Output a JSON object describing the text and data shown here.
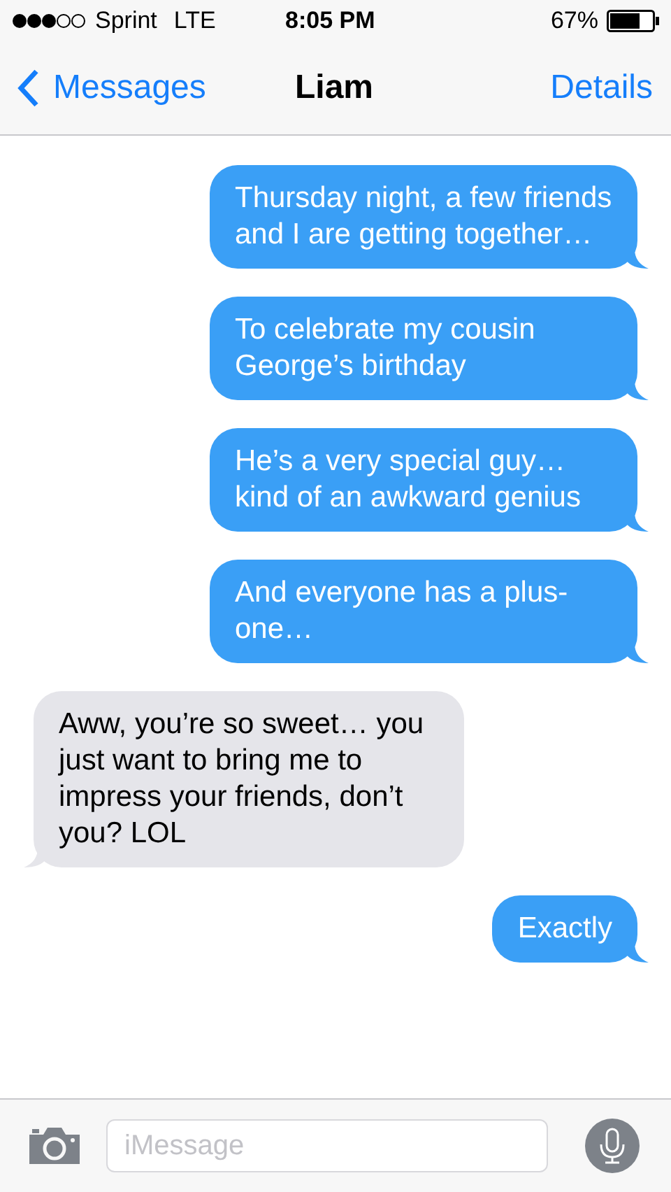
{
  "status_bar": {
    "carrier": "Sprint",
    "network": "LTE",
    "time": "8:05 PM",
    "battery": "67%"
  },
  "nav": {
    "back": "Messages",
    "title": "Liam",
    "action": "Details"
  },
  "messages": [
    {
      "kind": "sent",
      "text": "Thursday night, a few friends and I are getting together…"
    },
    {
      "kind": "sent",
      "text": "To celebrate my cousin George’s birthday"
    },
    {
      "kind": "sent",
      "text": "He’s a very special guy… kind of an awkward genius"
    },
    {
      "kind": "sent",
      "text": "And everyone has a plus-one…"
    },
    {
      "kind": "received",
      "text": "Aww, you’re so sweet… you just want to bring me to impress your friends, don’t you? LOL"
    },
    {
      "kind": "sent",
      "text": "Exactly"
    }
  ],
  "composer": {
    "placeholder": "iMessage"
  }
}
